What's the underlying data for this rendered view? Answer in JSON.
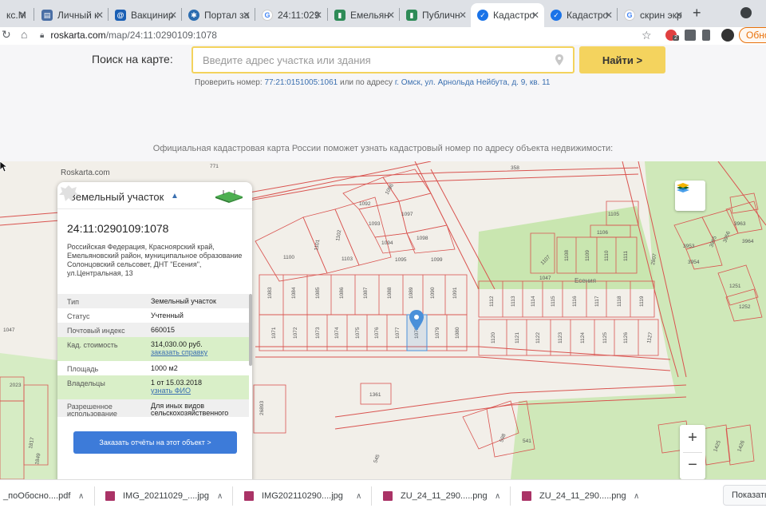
{
  "browser": {
    "tabs": [
      {
        "title": "кс.М",
        "favicon": "generic-tab-icon",
        "active": false
      },
      {
        "title": "Личный к",
        "favicon": "personal-account-icon",
        "active": false
      },
      {
        "title": "Вакцинир",
        "favicon": "vaccination-icon",
        "active": false
      },
      {
        "title": "Портал за",
        "favicon": "portal-icon",
        "active": false
      },
      {
        "title": "24:11:029",
        "favicon": "google-icon",
        "active": false
      },
      {
        "title": "Емельян",
        "favicon": "map-site-icon",
        "active": false
      },
      {
        "title": "Публичн",
        "favicon": "map-site-icon",
        "active": false
      },
      {
        "title": "Кадастро",
        "favicon": "check-badge-icon",
        "active": true
      },
      {
        "title": "Кадастро",
        "favicon": "check-badge-icon",
        "active": false
      },
      {
        "title": "скрин экр",
        "favicon": "google-icon",
        "active": false
      }
    ],
    "url_host": "roskarta.com",
    "url_path": "/map/24:11:0290109:1078",
    "update_label": "Обно",
    "ext_badge": "2"
  },
  "search": {
    "label": "Поиск на карте:",
    "placeholder": "Введите адрес участка или здания",
    "button": "Найти >",
    "hint_prefix": "Проверить номер:",
    "hint_number": "77:21:0151005:1061",
    "hint_middle": "или по адресу",
    "hint_address": "г. Омск, ул. Арнольда Нейбута, д. 9, кв. 11"
  },
  "info_text": "Официальная кадастровая карта России поможет узнать кадастровый номер по адресу объекта недвижимости:",
  "map": {
    "brand": "Roskarta.com",
    "village_label": "Есения",
    "zoom_in": "+",
    "zoom_out": "−",
    "parcel_numbers": [
      "771",
      "358",
      "1096",
      "1092",
      "1097",
      "1093",
      "1098",
      "1094",
      "1095",
      "1099",
      "1100",
      "1101",
      "1102",
      "1103",
      "1105",
      "1106",
      "1107",
      "1108",
      "1109",
      "1110",
      "1111",
      "1047",
      "1083",
      "1084",
      "1085",
      "1086",
      "1087",
      "1088",
      "1089",
      "1090",
      "1091",
      "1112",
      "1113",
      "1114",
      "1115",
      "1116",
      "1117",
      "1118",
      "1119",
      "1071",
      "1072",
      "1073",
      "1074",
      "1075",
      "1076",
      "1077",
      "1078",
      "1079",
      "1080",
      "1120",
      "1121",
      "1122",
      "1123",
      "1124",
      "1125",
      "1126",
      "1127",
      "1361",
      "1047",
      "3963",
      "3953",
      "3955",
      "3956",
      "3964",
      "3954",
      "1251",
      "1252",
      "26893",
      "598",
      "541",
      "545",
      "1425",
      "1426",
      "2023",
      "1817",
      "1849"
    ]
  },
  "card": {
    "title": "Земельный участок",
    "cadastral_number": "24:11:0290109:1078",
    "address": "Российская Федерация, Красноярский край, Емельяновский район, муниципальное образование Солонцовский сельсовет, ДНТ \"Есения\", ул.Центральная, 13",
    "rows": [
      {
        "key": "Тип",
        "value": "Земельный участок"
      },
      {
        "key": "Статус",
        "value": "Учтенный"
      },
      {
        "key": "Почтовый индекс",
        "value": "660015"
      },
      {
        "key": "Кад. стоимость",
        "value": "314,030.00 руб.",
        "link": "заказать справку"
      },
      {
        "key": "Площадь",
        "value": "1000 м2"
      },
      {
        "key": "Владельцы",
        "value": "1 от 15.03.2018",
        "link": "узнать ФИО"
      },
      {
        "key": "Разрешенное использование",
        "value": "Для иных видов сельскохозяйственного"
      }
    ],
    "order_button": "Заказать отчёты на этот объект >"
  },
  "downloads": [
    {
      "name": "_поОбосно....pdf",
      "type": "pdf"
    },
    {
      "name": "IMG_20211029_....jpg",
      "type": "jpg"
    },
    {
      "name": "IMG202110290....jpg",
      "type": "jpg"
    },
    {
      "name": "ZU_24_11_290.....png",
      "type": "png"
    },
    {
      "name": "ZU_24_11_290.....png",
      "type": "png"
    }
  ],
  "show_all": "Показать",
  "colors": {
    "accent_yellow": "#f4d35e",
    "parcel_line": "#d9534f",
    "green_zone": "#c9e6b0",
    "button_blue": "#3d7bd9",
    "marker_blue": "#4a90d9"
  }
}
